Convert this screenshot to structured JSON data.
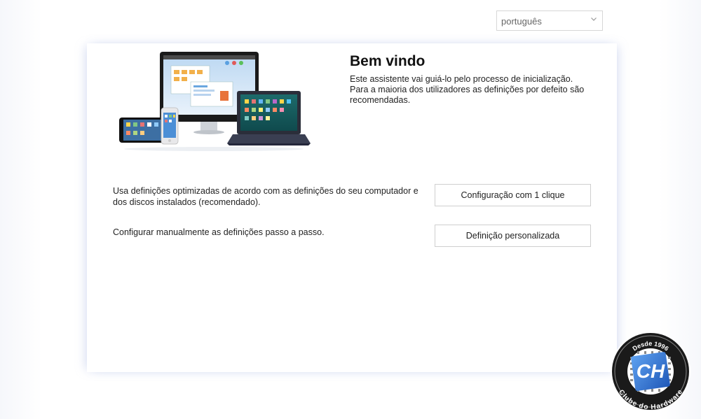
{
  "language_select": {
    "value": "português"
  },
  "welcome": {
    "title": "Bem vindo",
    "description": "Este assistente vai guiá-lo pelo processo de inicialização. Para a maioria dos utilizadores as definições por defeito são recomendadas."
  },
  "options": [
    {
      "description": "Usa definições optimizadas de acordo com as definições do seu computador e dos discos instalados (recomendado).",
      "button_label": "Configuração com 1 clique"
    },
    {
      "description": "Configurar manualmente as definições passo a passo.",
      "button_label": "Definição personalizada"
    }
  ],
  "watermark": {
    "top_text": "Desde 1996",
    "bottom_text": "Clube do Hardware",
    "logo_text": "CH"
  },
  "icons": {
    "language_chevron": "chevron-down-icon",
    "hero": "devices-illustration"
  },
  "colors": {
    "panel_glow": "#a5b4e6",
    "button_border": "#cfcfcf",
    "badge_blue": "#2f6fd6"
  }
}
